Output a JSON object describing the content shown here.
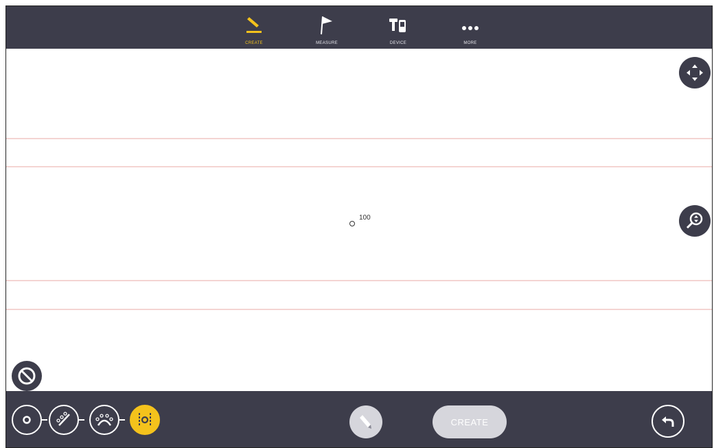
{
  "topbar": {
    "tabs": [
      {
        "label": "CREATE",
        "icon": "pencil-icon",
        "active": true
      },
      {
        "label": "MEASURE",
        "icon": "flag-icon",
        "active": false
      },
      {
        "label": "DEVICE",
        "icon": "device-icon",
        "active": false
      },
      {
        "label": "MORE",
        "icon": "more-dots-icon",
        "active": false
      }
    ]
  },
  "canvas": {
    "point_label": "100",
    "buttons": [
      "pan-icon",
      "zoom-icon",
      "cancel-icon",
      "info-icon"
    ]
  },
  "bottombar": {
    "modes": [
      {
        "name": "point-mode",
        "icon": "point-icon",
        "active": false
      },
      {
        "name": "line-mode",
        "icon": "line-icon",
        "active": false
      },
      {
        "name": "arc-mode",
        "icon": "arc-icon",
        "active": false
      },
      {
        "name": "offset-mode",
        "icon": "offset-icon",
        "active": true
      }
    ],
    "create_label": "CREATE"
  },
  "colors": {
    "bar": "#3d3d4b",
    "accent": "#f4c21c",
    "guide": "#f4d4d2",
    "disabled": "#d6d6dc"
  }
}
